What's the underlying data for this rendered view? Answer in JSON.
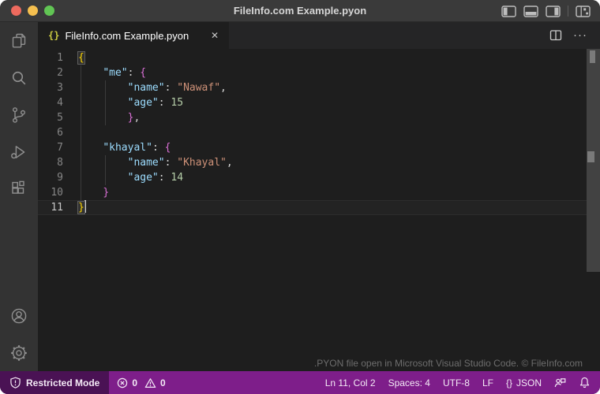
{
  "colors": {
    "title-bar-bg": "#3a3a3a",
    "tab-bar-bg": "#252526",
    "active-tab-bg": "#1e1e1e",
    "activity-bar-bg": "#333333",
    "editor-bg": "#1e1e1e",
    "status-bg": "#7e1e8a",
    "status-prominent-bg": "#4a1254",
    "tl-red": "#ed6a5e",
    "tl-yellow": "#f5bf4f",
    "tl-green": "#61c554",
    "json-icon": "#cbcb41",
    "tok-key": "#9cdcfe",
    "tok-str": "#ce9178",
    "tok-num": "#b5cea8",
    "tok-plain": "#d4d4d4",
    "tok-b1": "#ffd700",
    "tok-b2": "#da70d6"
  },
  "title_bar": {
    "title": "FileInfo.com Example.pyon"
  },
  "tab": {
    "icon_label": "{}",
    "label": "FileInfo.com Example.pyon",
    "close_label": "✕"
  },
  "editor_actions": {
    "more_label": "···"
  },
  "activity_bar": {
    "items": [
      "explorer",
      "search",
      "source-control",
      "run-and-debug",
      "extensions"
    ],
    "bottom_items": [
      "accounts",
      "settings"
    ]
  },
  "editor": {
    "watermark": ".PYON file open in Microsoft Visual Studio Code. © FileInfo.com",
    "lines": [
      {
        "num": "1",
        "segs": [
          {
            "t": "{",
            "c": "b1",
            "box": true
          }
        ]
      },
      {
        "num": "2",
        "segs": [
          {
            "t": "    ",
            "c": "plain"
          },
          {
            "t": "\"me\"",
            "c": "key"
          },
          {
            "t": ": ",
            "c": "plain"
          },
          {
            "t": "{",
            "c": "b2"
          }
        ]
      },
      {
        "num": "3",
        "segs": [
          {
            "t": "        ",
            "c": "plain"
          },
          {
            "t": "\"name\"",
            "c": "key"
          },
          {
            "t": ": ",
            "c": "plain"
          },
          {
            "t": "\"Nawaf\"",
            "c": "str"
          },
          {
            "t": ",",
            "c": "plain"
          }
        ]
      },
      {
        "num": "4",
        "segs": [
          {
            "t": "        ",
            "c": "plain"
          },
          {
            "t": "\"age\"",
            "c": "key"
          },
          {
            "t": ": ",
            "c": "plain"
          },
          {
            "t": "15",
            "c": "num"
          }
        ]
      },
      {
        "num": "5",
        "segs": [
          {
            "t": "        ",
            "c": "plain"
          },
          {
            "t": "}",
            "c": "b2"
          },
          {
            "t": ",",
            "c": "plain"
          }
        ]
      },
      {
        "num": "6",
        "segs": []
      },
      {
        "num": "7",
        "segs": [
          {
            "t": "    ",
            "c": "plain"
          },
          {
            "t": "\"khayal\"",
            "c": "key"
          },
          {
            "t": ": ",
            "c": "plain"
          },
          {
            "t": "{",
            "c": "b2"
          }
        ]
      },
      {
        "num": "8",
        "segs": [
          {
            "t": "        ",
            "c": "plain"
          },
          {
            "t": "\"name\"",
            "c": "key"
          },
          {
            "t": ": ",
            "c": "plain"
          },
          {
            "t": "\"Khayal\"",
            "c": "str"
          },
          {
            "t": ",",
            "c": "plain"
          }
        ]
      },
      {
        "num": "9",
        "segs": [
          {
            "t": "        ",
            "c": "plain"
          },
          {
            "t": "\"age\"",
            "c": "key"
          },
          {
            "t": ": ",
            "c": "plain"
          },
          {
            "t": "14",
            "c": "num"
          }
        ]
      },
      {
        "num": "10",
        "segs": [
          {
            "t": "    ",
            "c": "plain"
          },
          {
            "t": "}",
            "c": "b2"
          }
        ]
      },
      {
        "num": "11",
        "current": true,
        "cursor": true,
        "segs": [
          {
            "t": "}",
            "c": "b1",
            "box": true
          }
        ]
      }
    ]
  },
  "status_bar": {
    "restricted_label": "Restricted Mode",
    "error_count": "0",
    "warning_count": "0",
    "cursor": "Ln 11, Col 2",
    "indent": "Spaces: 4",
    "encoding": "UTF-8",
    "eol": "LF",
    "language_icon": "{}",
    "language": "JSON"
  }
}
